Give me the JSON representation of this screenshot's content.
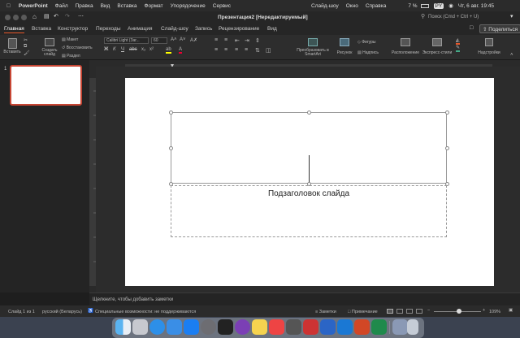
{
  "menubar": {
    "app": "PowerPoint",
    "items": [
      "Файл",
      "Правка",
      "Вид",
      "Вставка",
      "Формат",
      "Упорядочение",
      "Сервис",
      "Слайд-шоу",
      "Окно",
      "Справка"
    ],
    "battery": "7 %",
    "lang": "PY",
    "datetime": "Чт, 6 авг. 19:45"
  },
  "titlebar": {
    "title": "Презентация2 [Нередактируемый]",
    "search_placeholder": "Поиск (Cmd + Ctrl + U)"
  },
  "tabs": [
    "Главная",
    "Вставка",
    "Конструктор",
    "Переходы",
    "Анимация",
    "Слайд-шоу",
    "Запись",
    "Рецензирование",
    "Вид"
  ],
  "share_label": "Поделиться",
  "ribbon": {
    "paste": "Вставить",
    "new_slide": "Создать слайд",
    "layout": "Макет",
    "reset": "Восстановить",
    "section": "Раздел",
    "font": "Calibri Light (Заг...",
    "font_size": "60",
    "convert_smartart": "Преобразовать в SmartArt",
    "picture": "Рисунок",
    "shapes": "Фигуры",
    "textbox": "Надпись",
    "arrange": "Расположение",
    "quick_styles": "Экспресс-стили",
    "addins": "Надстройки"
  },
  "thumb_number": "1",
  "slide": {
    "subtitle": "Подзаголовок слайда"
  },
  "notes_placeholder": "Щелкните, чтобы добавить заметки",
  "status": {
    "slide_of": "Слайд 1 из 1",
    "language": "русский (Беларусь)",
    "accessibility": "Специальные возможности: не поддерживаются",
    "notes": "Заметки",
    "comments": "Примечание",
    "zoom": "109%"
  },
  "dock_count": 19,
  "colors": {
    "accent": "#e8572a",
    "slide_border": "#c74634"
  }
}
